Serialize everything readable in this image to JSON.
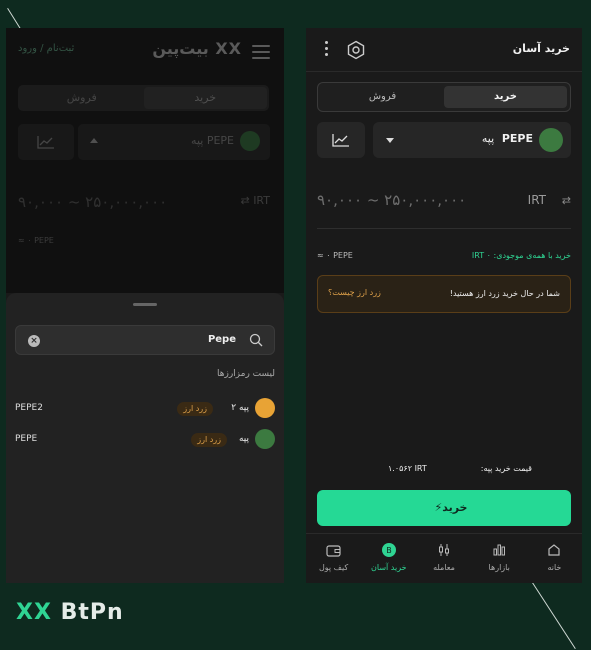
{
  "left": {
    "header": {
      "logo": "XX بیت‌پین",
      "auth": "ثبت‌نام / ورود"
    },
    "tabs": [
      "خرید",
      "فروش"
    ],
    "coin": "PEPE  پپه",
    "range": "۹۰,۰۰۰ ~ ۲۵۰,۰۰۰,۰۰۰",
    "irt": "IRT",
    "balance": "≈ ۰ PEPE",
    "search": {
      "query": "Pepe"
    },
    "list_title": "لیست رمزارزها",
    "results": [
      {
        "symbol": "PEPE2",
        "name": "پپه ۲",
        "badge": "زرد ارز",
        "color": "#e8a335"
      },
      {
        "symbol": "PEPE",
        "name": "پپه",
        "badge": "زرد ارز",
        "color": "#3c7a40"
      }
    ]
  },
  "right": {
    "title": "خرید آسان",
    "tabs": {
      "buy": "خرید",
      "sell": "فروش"
    },
    "coin": {
      "symbol": "PEPE",
      "name": "پپه"
    },
    "range": "۹۰,۰۰۰ ~ ۲۵۰,۰۰۰,۰۰۰",
    "irt": "IRT",
    "balance": "≈ ۰ PEPE",
    "buy_all": "خرید با همه‌ی موجودی: IRT ۰",
    "alert": {
      "message": "شما در حال خرید زرد ارز هستید!",
      "link": "زرد ارز چیست؟"
    },
    "price_label": "قیمت خرید پپه:",
    "price_value": "۱.۰۵۶۲ IRT",
    "buy_button": "خرید",
    "nav": [
      "خانه",
      "بازارها",
      "معامله",
      "خرید آسان",
      "کیف پول"
    ]
  },
  "brand": {
    "a": "XX",
    "b": "BtPn"
  }
}
